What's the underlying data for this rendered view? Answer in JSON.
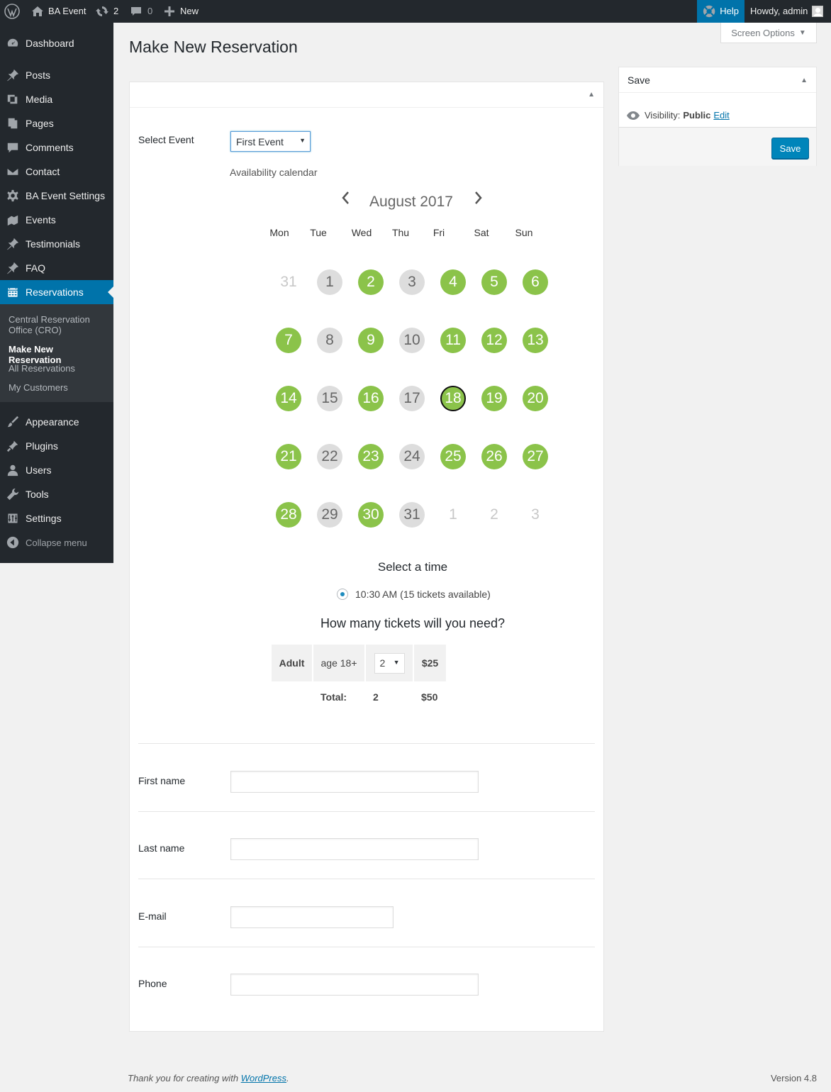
{
  "adminbar": {
    "site_name": "BA Event",
    "updates_count": "2",
    "comments_count": "0",
    "new_label": "New",
    "help_label": "Help",
    "howdy": "Howdy, admin"
  },
  "screen_options": "Screen Options",
  "sidebar": {
    "items": [
      {
        "label": "Dashboard",
        "icon": "dashboard-icon"
      },
      {
        "label": "Posts",
        "icon": "pin-icon"
      },
      {
        "label": "Media",
        "icon": "media-icon"
      },
      {
        "label": "Pages",
        "icon": "pages-icon"
      },
      {
        "label": "Comments",
        "icon": "comment-icon"
      },
      {
        "label": "Contact",
        "icon": "mail-icon"
      },
      {
        "label": "BA Event Settings",
        "icon": "gear-icon"
      },
      {
        "label": "Events",
        "icon": "events-icon"
      },
      {
        "label": "Testimonials",
        "icon": "pin-icon"
      },
      {
        "label": "FAQ",
        "icon": "pin-icon"
      },
      {
        "label": "Reservations",
        "icon": "calendar-icon"
      },
      {
        "label": "Appearance",
        "icon": "brush-icon"
      },
      {
        "label": "Plugins",
        "icon": "plugin-icon"
      },
      {
        "label": "Users",
        "icon": "user-icon"
      },
      {
        "label": "Tools",
        "icon": "wrench-icon"
      },
      {
        "label": "Settings",
        "icon": "settings-icon"
      },
      {
        "label": "Collapse menu",
        "icon": "collapse-icon"
      }
    ],
    "submenu": [
      "Central Reservation Office (CRO)",
      "Make New Reservation",
      "All Reservations",
      "My Customers"
    ]
  },
  "page_title": "Make New Reservation",
  "form": {
    "select_event_label": "Select Event",
    "selected_event": "First Event",
    "availability_label": "Availability calendar",
    "calendar": {
      "month": "August 2017",
      "weekdays": [
        "Mon",
        "Tue",
        "Wed",
        "Thu",
        "Fri",
        "Sat",
        "Sun"
      ],
      "weeks": [
        [
          {
            "d": "31",
            "s": "muted"
          },
          {
            "d": "1",
            "s": "gray"
          },
          {
            "d": "2",
            "s": "green"
          },
          {
            "d": "3",
            "s": "gray"
          },
          {
            "d": "4",
            "s": "green"
          },
          {
            "d": "5",
            "s": "green"
          },
          {
            "d": "6",
            "s": "green"
          }
        ],
        [
          {
            "d": "7",
            "s": "green"
          },
          {
            "d": "8",
            "s": "gray"
          },
          {
            "d": "9",
            "s": "green"
          },
          {
            "d": "10",
            "s": "gray"
          },
          {
            "d": "11",
            "s": "green"
          },
          {
            "d": "12",
            "s": "green"
          },
          {
            "d": "13",
            "s": "green"
          }
        ],
        [
          {
            "d": "14",
            "s": "green"
          },
          {
            "d": "15",
            "s": "gray"
          },
          {
            "d": "16",
            "s": "green"
          },
          {
            "d": "17",
            "s": "gray"
          },
          {
            "d": "18",
            "s": "green selected"
          },
          {
            "d": "19",
            "s": "green"
          },
          {
            "d": "20",
            "s": "green"
          }
        ],
        [
          {
            "d": "21",
            "s": "green"
          },
          {
            "d": "22",
            "s": "gray"
          },
          {
            "d": "23",
            "s": "green"
          },
          {
            "d": "24",
            "s": "gray"
          },
          {
            "d": "25",
            "s": "green"
          },
          {
            "d": "26",
            "s": "green"
          },
          {
            "d": "27",
            "s": "green"
          }
        ],
        [
          {
            "d": "28",
            "s": "green"
          },
          {
            "d": "29",
            "s": "gray"
          },
          {
            "d": "30",
            "s": "green"
          },
          {
            "d": "31",
            "s": "gray"
          },
          {
            "d": "1",
            "s": "muted"
          },
          {
            "d": "2",
            "s": "muted"
          },
          {
            "d": "3",
            "s": "muted"
          }
        ]
      ]
    },
    "select_time_heading": "Select a time",
    "time_option": "10:30 AM",
    "time_availability": "(15 tickets available)",
    "tickets_heading": "How many tickets will you need?",
    "ticket_row": {
      "type": "Adult",
      "age": "age 18+",
      "qty": "2",
      "price": "$25"
    },
    "total_label": "Total:",
    "total_qty": "2",
    "total_price": "$50",
    "first_name_label": "First name",
    "last_name_label": "Last name",
    "email_label": "E-mail",
    "phone_label": "Phone"
  },
  "savebox": {
    "title": "Save",
    "visibility_label": "Visibility:",
    "visibility_value": "Public",
    "edit_link": "Edit",
    "save_button": "Save"
  },
  "footer": {
    "thanks_prefix": "Thank you for creating with",
    "wordpress_link": "WordPress",
    "thanks_suffix": ".",
    "version": "Version 4.8"
  },
  "colors": {
    "available": "#8bc34a",
    "unavailable": "#dddddd",
    "accent": "#0073aa"
  }
}
